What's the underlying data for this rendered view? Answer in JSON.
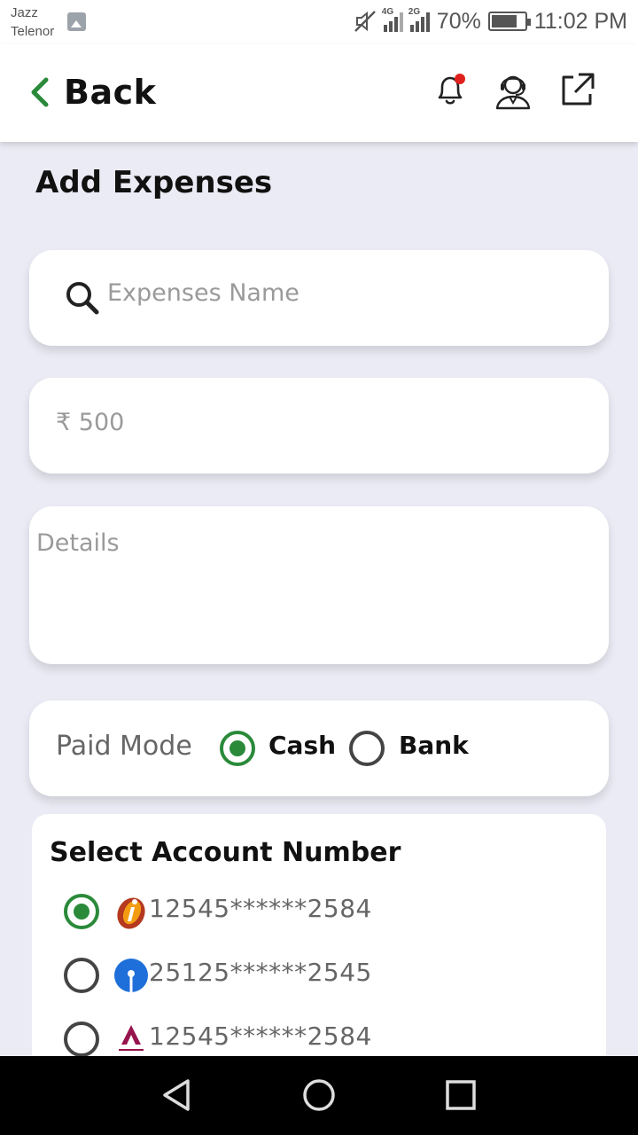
{
  "status_bar": {
    "carrier_1": "Jazz",
    "carrier_2": "Telenor",
    "net_1": "4G",
    "net_2": "2G",
    "battery": "70%",
    "time": "11:02 PM"
  },
  "header": {
    "back_label": "Back",
    "icons": [
      "bell-icon",
      "support-agent-icon",
      "external-link-icon"
    ],
    "accent_color": "#2a8a3a",
    "notification_dot_color": "#e0201b"
  },
  "page": {
    "title": "Add Expenses"
  },
  "form": {
    "name_placeholder": "Expenses Name",
    "amount_placeholder": "₹ 500",
    "details_placeholder": "Details",
    "paid_mode": {
      "label": "Paid Mode",
      "options": [
        "Cash",
        "Bank"
      ],
      "selected": "Cash"
    }
  },
  "accounts": {
    "title": "Select Account Number",
    "items": [
      {
        "number": "12545******2584",
        "bank_logo": "icici-logo-icon",
        "selected": true
      },
      {
        "number": "25125******2545",
        "bank_logo": "sbi-logo-icon",
        "selected": false
      },
      {
        "number": "12545******2584",
        "bank_logo": "axis-logo-icon",
        "selected": false
      }
    ]
  },
  "nav": [
    "back-nav-icon",
    "home-nav-icon",
    "recents-nav-icon"
  ]
}
